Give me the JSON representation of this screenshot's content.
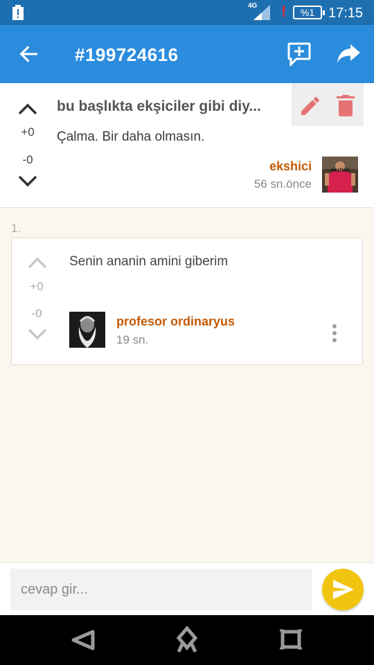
{
  "status_bar": {
    "network": "4G",
    "battery": "%1",
    "time": "17:15"
  },
  "app_bar": {
    "title": "#199724616"
  },
  "entry": {
    "title": "bu başlıkta ekşiciler gibi diy...",
    "body": "Çalma. Bir daha olmasın.",
    "upvotes": "+0",
    "downvotes": "-0",
    "author": "ekshici",
    "time": "56 sn.önce",
    "avatar_caption": "ekshici"
  },
  "reply_number": "1.",
  "reply": {
    "text": "Senin ananin amini giberim",
    "upvotes": "+0",
    "downvotes": "-0",
    "author": "profesor ordinaryus",
    "time": "19 sn."
  },
  "composer": {
    "placeholder": "cevap gir..."
  },
  "colors": {
    "status_bar": "#1e6fb0",
    "app_bar": "#2b8cde",
    "author": "#c25a06",
    "send": "#f1c40f",
    "delete": "#e57373",
    "background": "#fbf7ef"
  },
  "icons": {
    "back": "arrow-left-icon",
    "new_message": "comment-plus-icon",
    "share": "share-icon",
    "edit": "pencil-icon",
    "delete": "trash-icon",
    "upvote": "chevron-up-icon",
    "downvote": "chevron-down-icon",
    "more": "more-vertical-icon",
    "send": "send-icon"
  }
}
